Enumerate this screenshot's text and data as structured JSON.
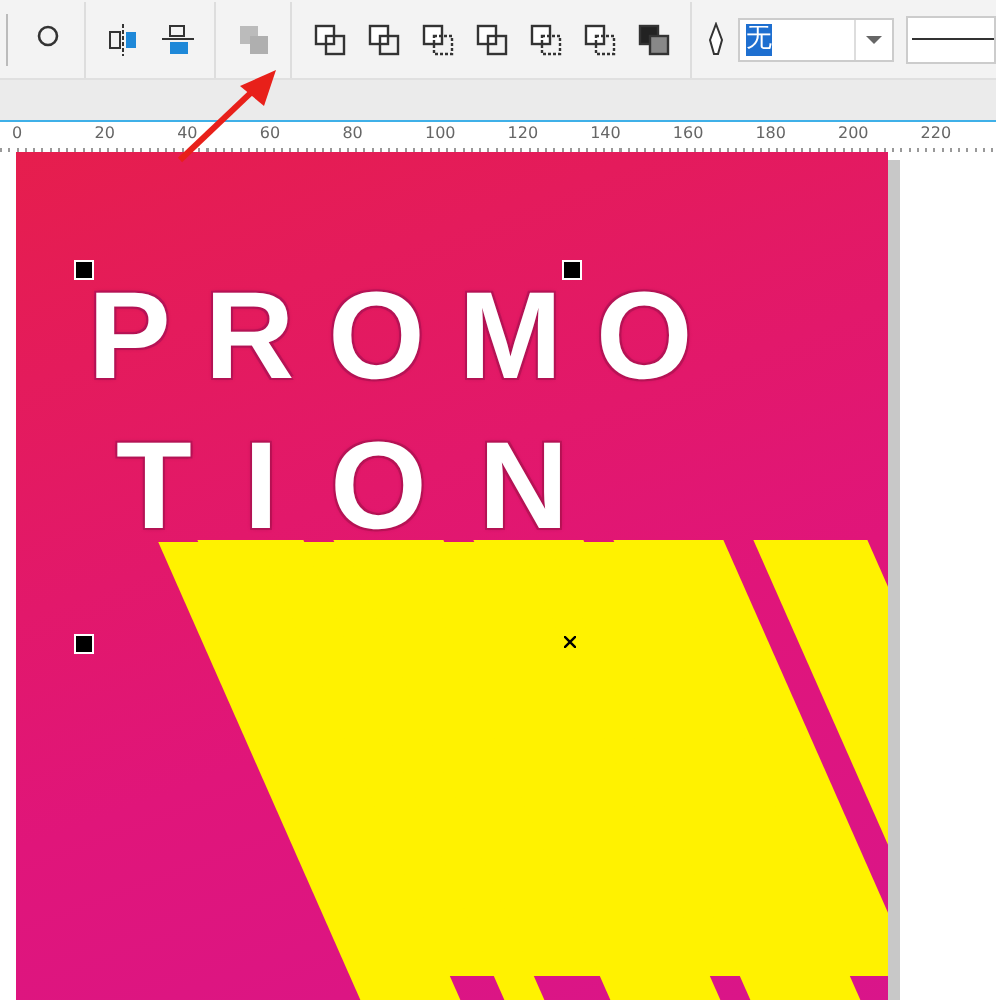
{
  "toolbar": {
    "tools": [
      {
        "kind": "circle",
        "disabled": false
      },
      {
        "kind": "mirror",
        "disabled": false
      },
      {
        "kind": "align",
        "disabled": false
      },
      {
        "kind": "stack",
        "disabled": true
      },
      {
        "kind": "shape",
        "disabled": false
      },
      {
        "kind": "shape",
        "disabled": false
      },
      {
        "kind": "shape-dashed",
        "disabled": false
      },
      {
        "kind": "shape",
        "disabled": false
      },
      {
        "kind": "shape-dashed",
        "disabled": false
      },
      {
        "kind": "shape-dashed",
        "disabled": false
      },
      {
        "kind": "shape-filled",
        "disabled": false
      }
    ],
    "outline": {
      "value": "无"
    }
  },
  "ruler": {
    "ticks": [
      "0",
      "20",
      "40",
      "60",
      "80",
      "100",
      "120",
      "140",
      "160",
      "180",
      "200",
      "220"
    ]
  },
  "canvas": {
    "lines": [
      "PROMO",
      "TION"
    ]
  }
}
